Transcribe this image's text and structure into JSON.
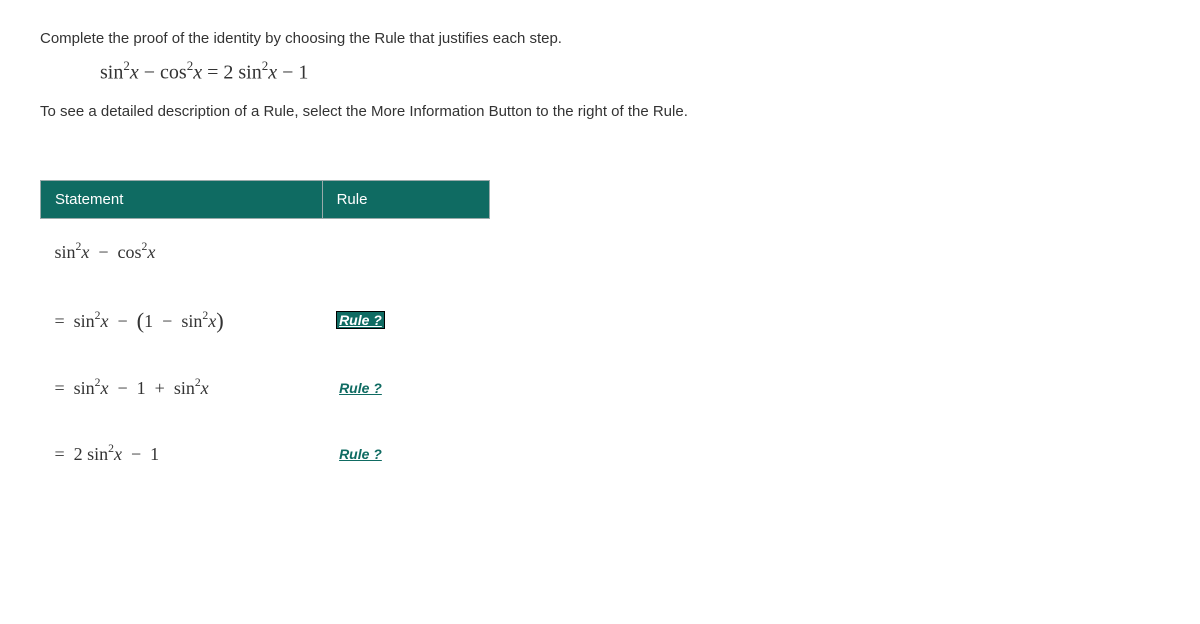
{
  "instruction1": "Complete the proof of the identity by choosing the Rule that justifies each step.",
  "equation_html": "sin<span class='sup'>2</span><i>x</i> − cos<span class='sup'>2</span><i>x</i> = 2 sin<span class='sup'>2</span><i>x</i> − 1",
  "instruction2": "To see a detailed description of a Rule, select the More Information Button to the right of the Rule.",
  "headers": {
    "statement": "Statement",
    "rule": "Rule"
  },
  "rows": [
    {
      "statement_html": "sin<span class='sup'>2</span><i>x</i> &nbsp;−&nbsp; cos<span class='sup'>2</span><i>x</i>",
      "rule": "",
      "selected": false
    },
    {
      "statement_html": "=&nbsp; sin<span class='sup'>2</span><i>x</i> &nbsp;−&nbsp; <span class='paren-big'>(</span>1 &nbsp;−&nbsp; sin<span class='sup'>2</span><i>x</i><span class='paren-big'>)</span>",
      "rule": "Rule ?",
      "selected": true
    },
    {
      "statement_html": "=&nbsp; sin<span class='sup'>2</span><i>x</i> &nbsp;−&nbsp; 1 &nbsp;+&nbsp; sin<span class='sup'>2</span><i>x</i>",
      "rule": "Rule ?",
      "selected": false
    },
    {
      "statement_html": "=&nbsp; 2 sin<span class='sup'>2</span><i>x</i> &nbsp;−&nbsp; 1",
      "rule": "Rule ?",
      "selected": false
    }
  ]
}
